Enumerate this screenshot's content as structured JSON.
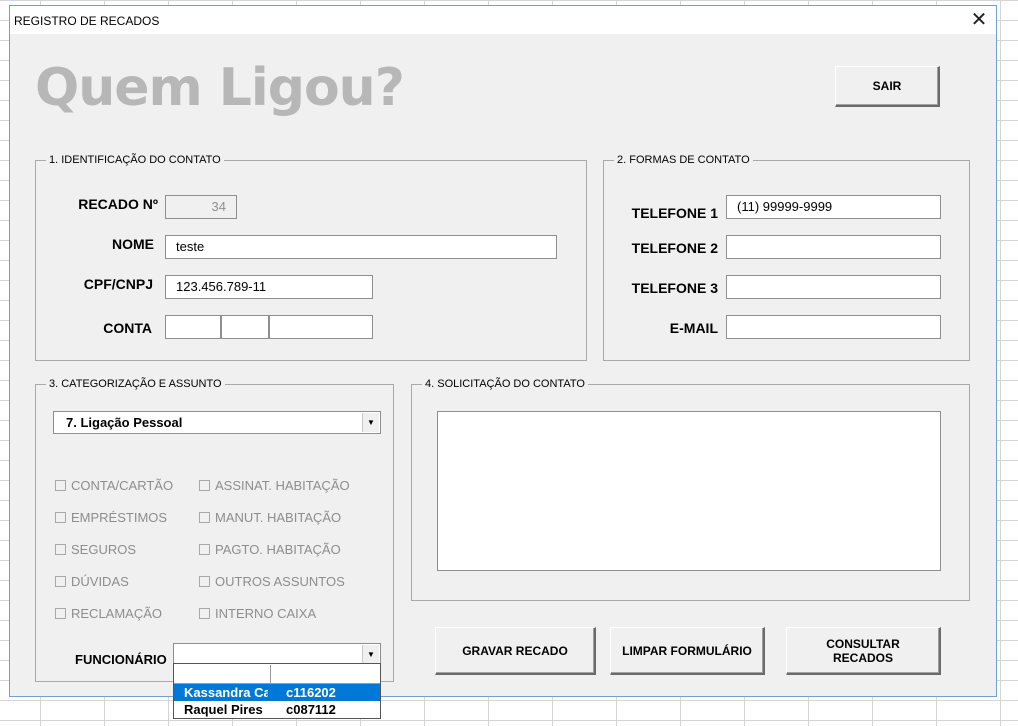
{
  "window": {
    "title": "REGISTRO DE RECADOS",
    "close_glyph": "✕"
  },
  "heading": "Quem Ligou?",
  "buttons": {
    "exit": "SAIR",
    "save": "GRAVAR RECADO",
    "clear": "LIMPAR FORMULÁRIO",
    "consult": "CONSULTAR RECADOS"
  },
  "identification": {
    "legend": "1. IDENTIFICAÇÃO DO CONTATO",
    "recado_label": "RECADO Nº",
    "recado_value": "34",
    "nome_label": "NOME",
    "nome_value": "teste",
    "cpf_label": "CPF/CNPJ",
    "cpf_value": "123.456.789-11",
    "conta_label": "CONTA",
    "conta_values": [
      "",
      "",
      ""
    ]
  },
  "contact_forms": {
    "legend": "2. FORMAS DE CONTATO",
    "tel1_label": "TELEFONE 1",
    "tel1_value": "(11) 99999-9999",
    "tel2_label": "TELEFONE 2",
    "tel2_value": "",
    "tel3_label": "TELEFONE 3",
    "tel3_value": "",
    "email_label": "E-MAIL",
    "email_value": ""
  },
  "categorization": {
    "legend": "3. CATEGORIZAÇÃO E ASSUNTO",
    "category_selected": "7. Ligação Pessoal",
    "checkboxes_left": [
      "CONTA/CARTÃO",
      "EMPRÉSTIMOS",
      "SEGUROS",
      "DÚVIDAS",
      "RECLAMAÇÃO"
    ],
    "checkboxes_right": [
      "ASSINAT. HABITAÇÃO",
      "MANUT. HABITAÇÃO",
      "PAGTO. HABITAÇÃO",
      "OUTROS ASSUNTOS",
      "INTERNO CAIXA"
    ],
    "funcionario_label": "FUNCIONÁRIO",
    "funcionario_value": "",
    "funcionario_options": [
      {
        "name": "Kassandra Car",
        "code": "c116202",
        "selected": true
      },
      {
        "name": "Raquel Pires",
        "code": "c087112",
        "selected": false
      }
    ]
  },
  "request": {
    "legend": "4. SOLICITAÇÃO DO CONTATO",
    "text": ""
  },
  "colors": {
    "heading": "#b7b7b7",
    "selection": "#0078d7",
    "disabled_text": "#8d8d8d"
  },
  "icons": {
    "dropdown_arrow": "chevron-down-icon",
    "close": "close-icon"
  }
}
